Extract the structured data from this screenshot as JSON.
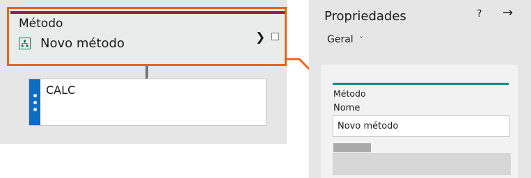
{
  "method_card": {
    "title": "Método",
    "name": "Novo método",
    "expand_glyph": "❯",
    "accent_color": "#a3174f",
    "icon": "org-chart-icon"
  },
  "calc_block": {
    "label": "CALC",
    "strip_color": "#0b6cc2"
  },
  "highlight_color": "#e8651a",
  "properties": {
    "title": "Propriedades",
    "help": "?",
    "close": "→",
    "tab": "Geral",
    "tab_chevron": "˅",
    "section_header": "Método",
    "name_label": "Nome",
    "name_value": "Novo método",
    "accent_color": "#0f8a82"
  }
}
